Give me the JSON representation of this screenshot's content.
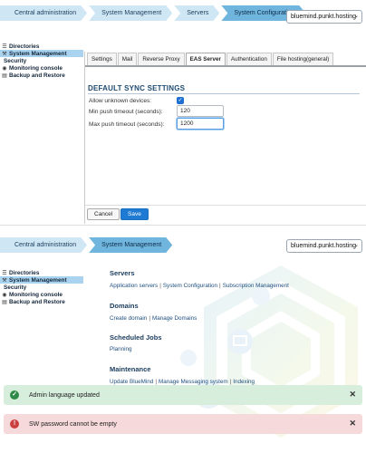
{
  "top": {
    "breadcrumbs": [
      "Central administration",
      "System Management",
      "Servers",
      "System Configuration"
    ],
    "domain": "bluemind.punkt.hosting",
    "nav": [
      "Directories",
      "System Management",
      "Security",
      "Monitoring console",
      "Backup and Restore"
    ],
    "tabs": [
      "Settings",
      "Mail",
      "Reverse Proxy",
      "EAS Server",
      "Authentication",
      "File hosting(general)"
    ],
    "active_tab": "EAS Server",
    "section_title": "DEFAULT SYNC SETTINGS",
    "fields": {
      "allow_unknown_label": "Allow unknown devices:",
      "allow_unknown_checked": true,
      "min_push_label": "Min push timeout (seconds):",
      "min_push_value": "120",
      "max_push_label": "Max push timeout (seconds):",
      "max_push_value": "1200"
    },
    "buttons": {
      "cancel": "Cancel",
      "save": "Save"
    }
  },
  "bottom": {
    "breadcrumbs": [
      "Central administration",
      "System Management"
    ],
    "domain": "bluemind.punkt.hosting",
    "nav": [
      "Directories",
      "System Management",
      "Security",
      "Monitoring console",
      "Backup and Restore"
    ],
    "sections": {
      "servers": {
        "title": "Servers",
        "links": [
          "Application servers",
          "System Configuration",
          "Subscription Management"
        ]
      },
      "domains": {
        "title": "Domains",
        "links": [
          "Create domain",
          "Manage Domains"
        ]
      },
      "jobs": {
        "title": "Scheduled Jobs",
        "links": [
          "Planning"
        ]
      },
      "maintenance": {
        "title": "Maintenance",
        "links": [
          "Update BlueMind",
          "Manage Messaging system",
          "Indexing"
        ]
      }
    },
    "toasts": {
      "success": "Admin language updated",
      "error": "SW password cannot be empty"
    }
  },
  "colors": {
    "crumb": "#cfe6f4",
    "crumb_current": "#6fb5dd",
    "nav_active": "#a9d3ef",
    "save_button": "#1e7ad2",
    "toast_success": "#d6eedb",
    "toast_error": "#f6d9da"
  },
  "icons": {
    "directories": "list-icon",
    "system_management": "wrench-icon",
    "security": "lock-icon",
    "monitoring": "monitor-icon",
    "backup": "archive-icon",
    "success": "check-circle-icon",
    "error": "exclamation-circle-icon",
    "close": "close-icon"
  }
}
